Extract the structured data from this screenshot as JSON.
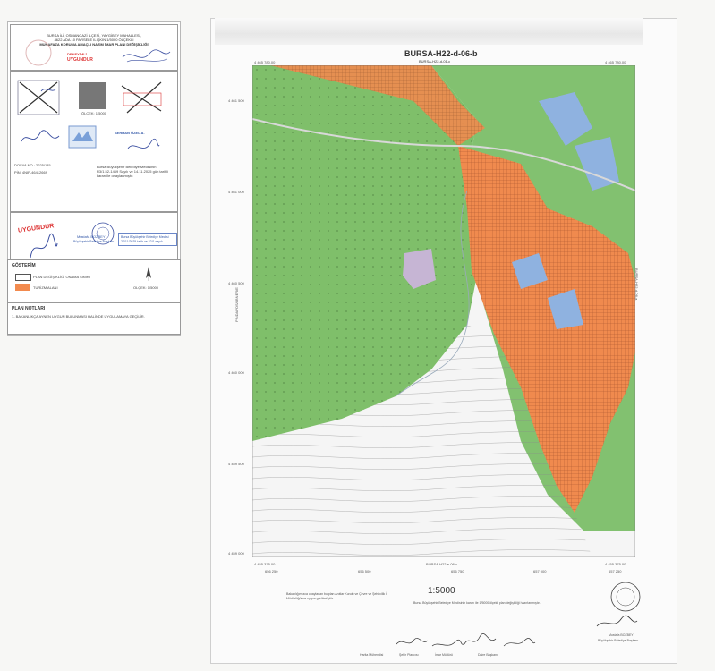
{
  "header": {
    "sheet_title": "BURSA-H22-d-06-b",
    "sheet_subtitle": "BURSA-H22-d-01-c",
    "bottom_sheet_ref": "BURSA-H22-e-06-c",
    "scale": "1:5000"
  },
  "approval": {
    "line1": "BURSA İLİ, OSMANGAZİ İLÇESİ, YAYGİBEY MAHALLESİ,",
    "line2": "4622 ADA 10 PARSELE İLİŞKİN 1/5000 ÖLÇEKLİ",
    "line3": "MUHAFAZA KORUMA AMAÇLI NAZIM İMAR PLANI DEĞİŞİKLİĞİ",
    "stamp_red_a": "DENEYİMLİ",
    "stamp_red_b": "UYGUNDUR",
    "stamp_red_c": "UYGUNDUR",
    "dosya_no": "DOSYA NO : 2025/145",
    "plan_no": "PİN: 4NIP-46412669",
    "mini_scale": "ÖLÇEK: 1/5000",
    "stamp_blue_name": "SERHAN ÖZEL A.",
    "stamp_blue_role": "Bursa Büyükşehir Belediye Meclisinin",
    "stamp_blue_decision": "R3/1.52-1469 Sayılı ve 14.11.2025 gün tarihli kararı ile onaylanmıştır.",
    "stamp_round_name": "Mustafa BOZBEY",
    "stamp_round_role": "Büyükşehir Belediye Başkanı",
    "stamp_blue_box": "Bursa Büyükşehir Belediye Meclisi 27/11/2025 tarih ve 22/1 sayılı"
  },
  "legend": {
    "title": "GÖSTERİM",
    "item1": "PLAN DEĞİŞİKLİĞİ ONAMA SINIRI",
    "item2": "TURİZM ALANI",
    "north_label": "OLÇEK: 1/5000"
  },
  "notes": {
    "title": "PLAN NOTLARI",
    "note1": "1- BAKANLIKÇA AYNEN UYGUN BULUNMASI HALİNDE UYGULAMAYA GEÇİLİR."
  },
  "coords": {
    "top_left": "4 465 780.00",
    "top_right": "4 465 780.00",
    "y1": "4 461 500",
    "y2": "4 461 000",
    "y3": "4 460 500",
    "y4": "4 460 000",
    "y5": "4 459 500",
    "y6": "4 459 000",
    "bottom_left": "4 455 375.00",
    "bottom_right": "4 455 375.00",
    "x1": "656 250",
    "x2": "656 500",
    "x3": "656 750",
    "x4": "657 000",
    "x5": "657 250"
  },
  "side_labels": {
    "left": "PINDAPOS/0BNER/E",
    "right": "BURSA-H22-d-06-a"
  },
  "footer": {
    "left_text": "Bakanlığımızca onaylanan bu plan Anıtlar Kurulu ve Çevre ve Şehircilik İl Müdürlüğünce uygun görülmüştür.",
    "center_text": "Bursa Büyükşehir Belediye Meclisinin kararı ile 1/5000 ölçekli plan değişikliği hazırlanmıştır.",
    "sign1": "Harita Mühendisi",
    "sign2": "Şehir Plancısı",
    "sign3": "İmar Müdürü",
    "sign4": "Daire Başkanı",
    "sign5": "Büyükşehir Belediye Başkanı",
    "stamp_right": "Mustafa BOZBEY"
  }
}
